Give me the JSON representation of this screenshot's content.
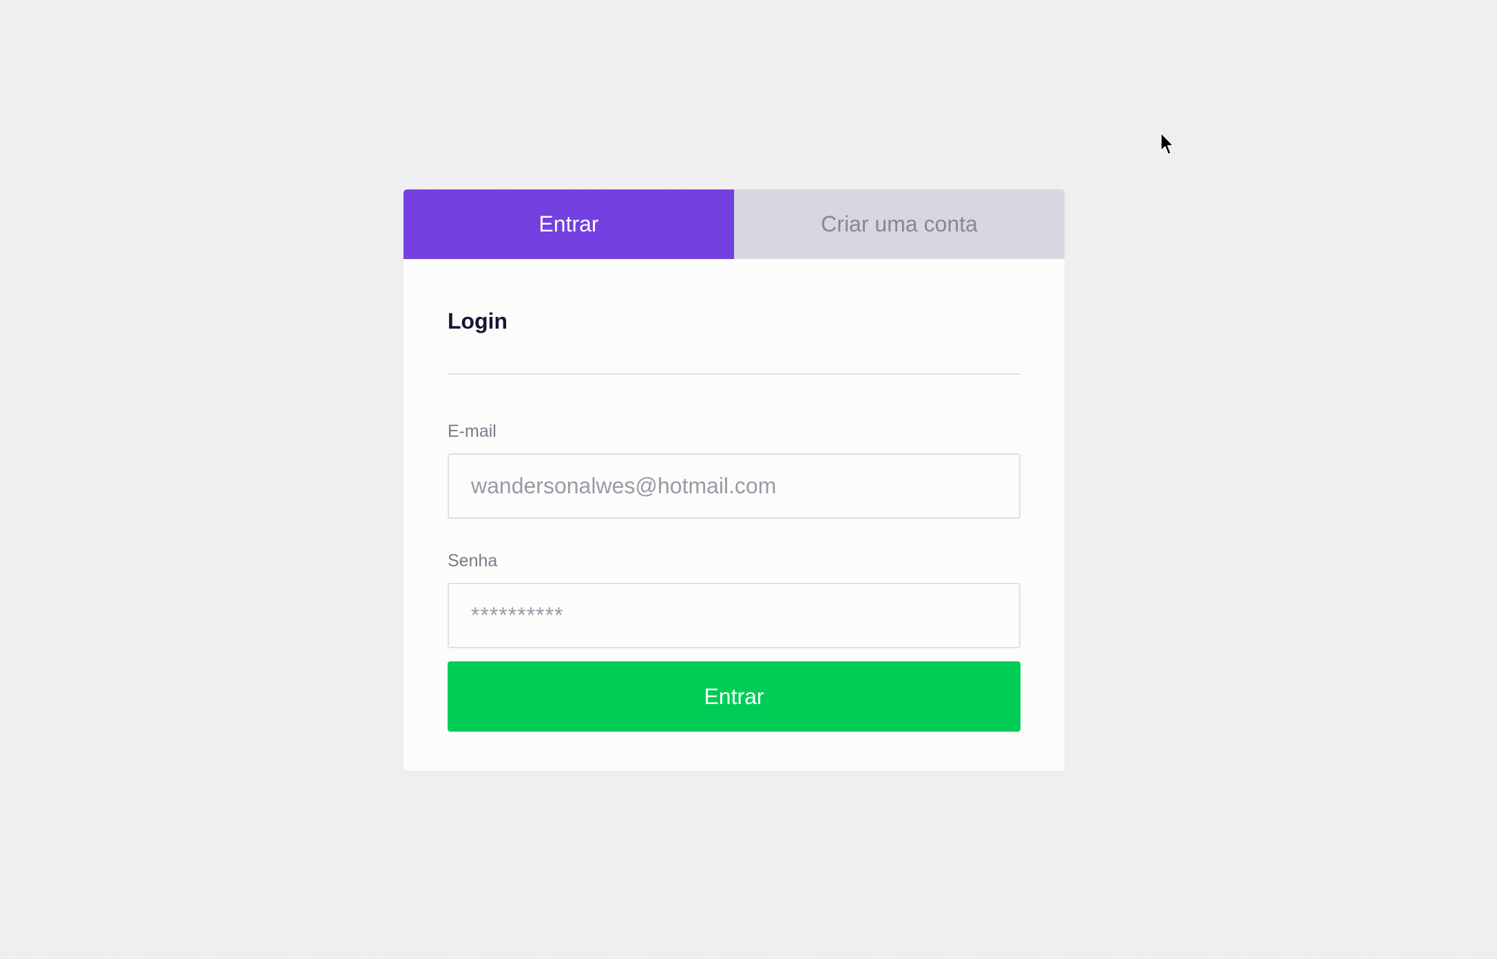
{
  "tabs": {
    "signin_label": "Entrar",
    "signup_label": "Criar uma conta"
  },
  "form": {
    "title": "Login",
    "email_label": "E-mail",
    "email_placeholder": "wandersonalwes@hotmail.com",
    "password_label": "Senha",
    "password_placeholder": "**********",
    "submit_label": "Entrar"
  },
  "colors": {
    "accent": "#7440e1",
    "submit": "#00cd55",
    "inactive_tab": "#d8d6df",
    "background": "#f0f0f2"
  },
  "icons": {
    "cursor": "mouse-pointer-icon"
  }
}
